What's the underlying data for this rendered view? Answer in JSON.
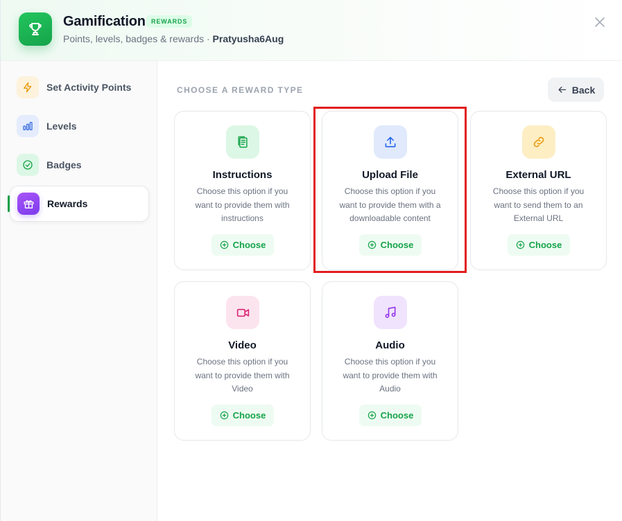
{
  "header": {
    "title": "Gamification",
    "badge": "REWARDS",
    "subtitle": "Points, levels, badges & rewards · ",
    "username": "Pratyusha6Aug",
    "app_icon": "trophy-icon",
    "close_icon": "close-icon"
  },
  "sidebar": {
    "items": [
      {
        "label": "Set Activity Points",
        "icon": "lightning-icon",
        "active": false
      },
      {
        "label": "Levels",
        "icon": "bar-chart-icon",
        "active": false
      },
      {
        "label": "Badges",
        "icon": "check-circle-icon",
        "active": false
      },
      {
        "label": "Rewards",
        "icon": "gift-icon",
        "active": true
      }
    ]
  },
  "main": {
    "section_title": "CHOOSE A REWARD TYPE",
    "back_label": "Back",
    "choose_label": "Choose",
    "cards": [
      {
        "title": "Instructions",
        "desc": "Choose this option if you want to provide them with instructions",
        "icon": "clipboard-icon",
        "color": "#16a34a"
      },
      {
        "title": "Upload File",
        "desc": "Choose this option if you want to provide them with a downloadable content",
        "icon": "upload-icon",
        "color": "#2563eb",
        "highlighted": true
      },
      {
        "title": "External URL",
        "desc": "Choose this option if you want to send them to an External URL",
        "icon": "link-icon",
        "color": "#ea9a0c"
      },
      {
        "title": "Video",
        "desc": "Choose this option if you want to provide them with Video",
        "icon": "video-icon",
        "color": "#db2777"
      },
      {
        "title": "Audio",
        "desc": "Choose this option if you want to provide them with Audio",
        "icon": "music-icon",
        "color": "#9333ea"
      }
    ]
  },
  "colors": {
    "accent": "#16a34a",
    "highlight": "#e11d1d"
  }
}
